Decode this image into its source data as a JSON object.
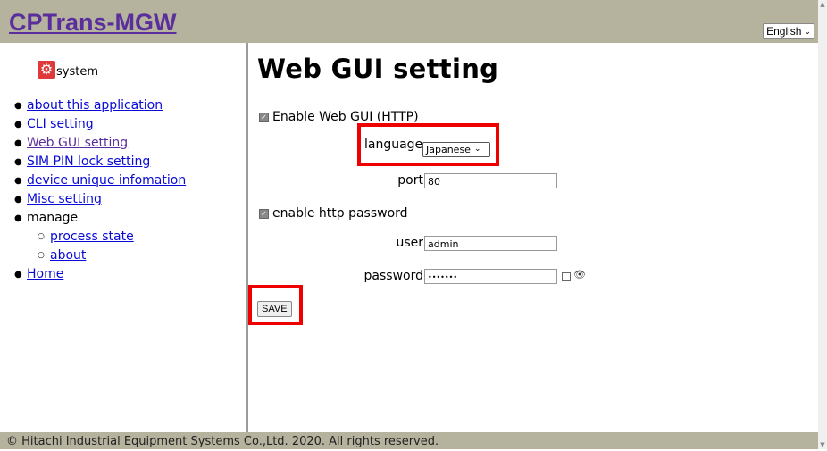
{
  "header": {
    "app_title": "CPTrans-MGW",
    "language_select": "English"
  },
  "sidebar": {
    "heading": "system",
    "items": [
      {
        "label": "about this application"
      },
      {
        "label": "CLI setting"
      },
      {
        "label": "Web GUI setting"
      },
      {
        "label": "SIM PIN lock setting"
      },
      {
        "label": "device unique infomation"
      },
      {
        "label": "Misc setting"
      },
      {
        "label": "manage"
      },
      {
        "label": "process state"
      },
      {
        "label": "about"
      },
      {
        "label": "Home"
      }
    ]
  },
  "main": {
    "title": "Web GUI setting",
    "enable_web_gui_label": "Enable Web GUI (HTTP)",
    "language_label": "language",
    "language_value": "Japanese",
    "port_label": "port",
    "port_value": "80",
    "enable_password_label": "enable http password",
    "user_label": "user",
    "user_value": "admin",
    "password_label": "password",
    "password_value": "•••••••",
    "save_label": "SAVE"
  },
  "footer": {
    "copyright": "© Hitachi Industrial Equipment Systems Co.,Ltd. 2020. All rights reserved."
  },
  "colors": {
    "header_bg": "#b5b29e",
    "highlight": "#ee0000",
    "title_link": "#5a2e9c"
  }
}
